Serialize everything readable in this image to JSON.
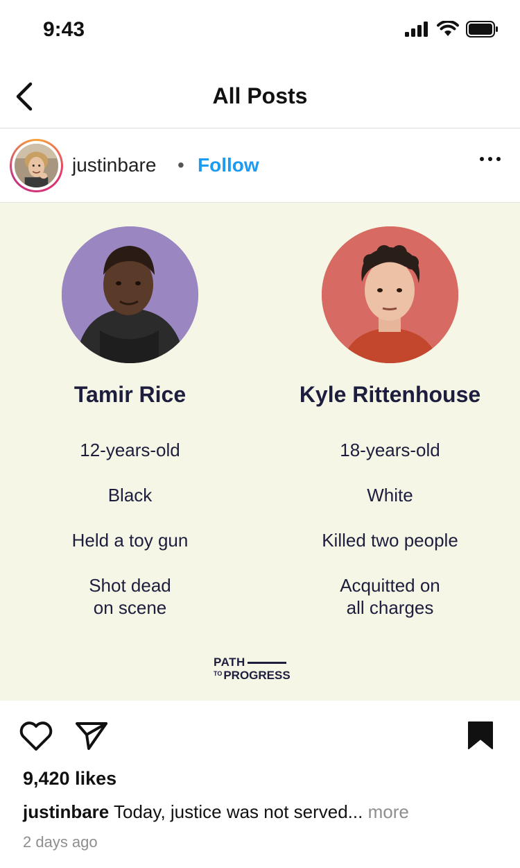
{
  "status_bar": {
    "time": "9:43"
  },
  "nav": {
    "title": "All Posts"
  },
  "post": {
    "username": "justinbare",
    "separator": "•",
    "follow_label": "Follow",
    "image": {
      "left_person": {
        "name": "Tamir Rice",
        "facts": [
          "12-years-old",
          "Black",
          "Held a toy gun",
          "Shot dead\non scene"
        ],
        "color": "#9a86c0"
      },
      "right_person": {
        "name": "Kyle Rittenhouse",
        "facts": [
          "18-years-old",
          "White",
          "Killed two people",
          "Acquitted on\nall charges"
        ],
        "color": "#d76a62"
      },
      "logo": {
        "line1": "PATH",
        "line2_small": "TO",
        "line2": "PROGRESS"
      }
    },
    "likes": "9,420 likes",
    "caption": {
      "user": "justinbare",
      "text": " Today, justice was not served... ",
      "more": "more"
    },
    "timestamp": "2 days ago"
  },
  "icons": {
    "signal": "cellular-signal-icon",
    "wifi": "wifi-icon",
    "battery": "battery-icon",
    "back": "chevron-left-icon",
    "more": "ellipsis-icon",
    "like": "heart-icon",
    "share": "paper-plane-icon",
    "save": "bookmark-icon"
  },
  "colors": {
    "follow": "#1d9bf0",
    "image_bg": "#f6f6e6",
    "text_dark": "#1d1d3e"
  }
}
